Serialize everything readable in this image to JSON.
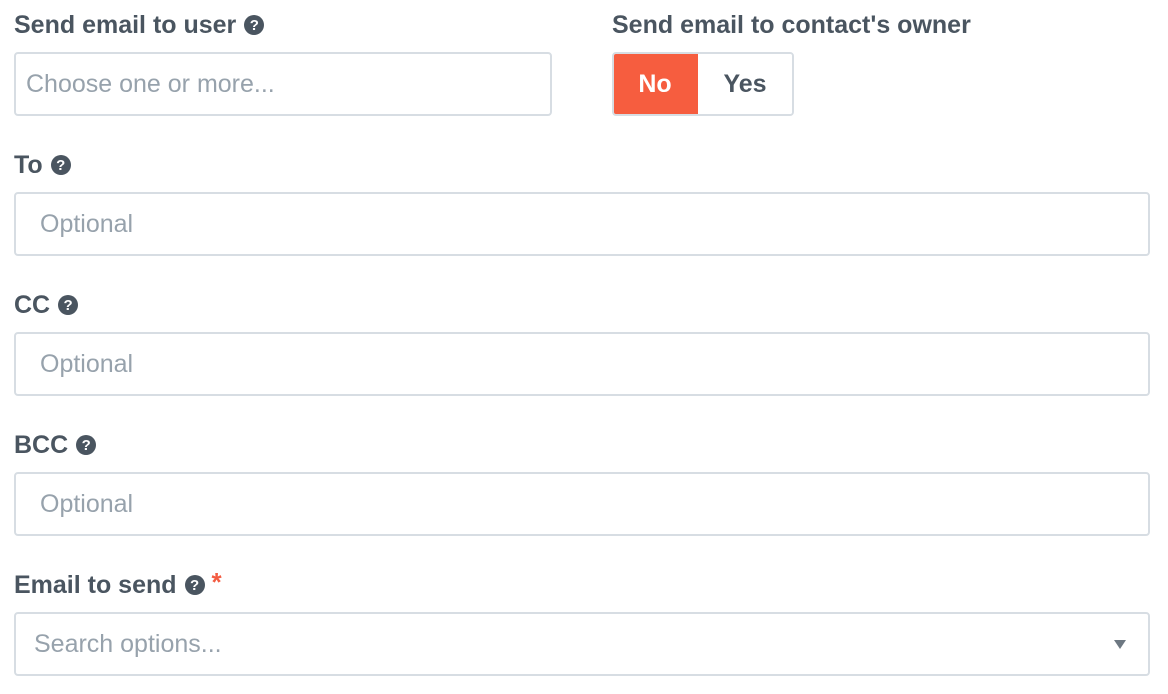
{
  "send_to_user": {
    "label": "Send email to user",
    "help_icon": "question-circle-icon",
    "placeholder": "Choose one or more..."
  },
  "send_to_owner": {
    "label": "Send email to contact's owner",
    "options": [
      "No",
      "Yes"
    ],
    "selected": "No",
    "active_color": "#f65d3f"
  },
  "to": {
    "label": "To",
    "help_icon": "question-circle-icon",
    "placeholder": "Optional"
  },
  "cc": {
    "label": "CC",
    "help_icon": "question-circle-icon",
    "placeholder": "Optional"
  },
  "bcc": {
    "label": "BCC",
    "help_icon": "question-circle-icon",
    "placeholder": "Optional"
  },
  "email_to_send": {
    "label": "Email to send",
    "help_icon": "question-circle-icon",
    "required_marker": "*",
    "placeholder": "Search options...",
    "dropdown_icon": "caret-down-icon"
  }
}
